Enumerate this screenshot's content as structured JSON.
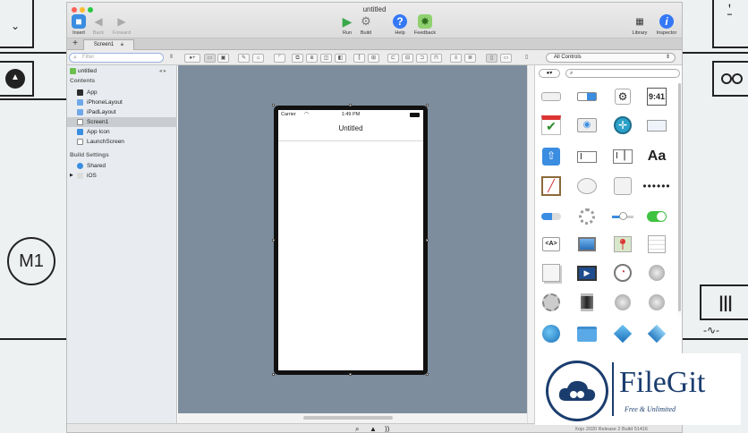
{
  "window": {
    "title": "untitled",
    "toolbar": {
      "insert": "Insert",
      "back": "Back",
      "forward": "Forward",
      "run": "Run",
      "build": "Build",
      "help": "Help",
      "feedback": "Feedback",
      "library": "Library",
      "inspector": "Inspector"
    },
    "tab_label": "Screen1"
  },
  "navigator": {
    "search_placeholder": "Filter",
    "root": "untitled",
    "contents_header": "Contents",
    "contents": [
      "App",
      "iPhoneLayout",
      "iPadLayout",
      "Screen1",
      "App Icon",
      "LaunchScreen"
    ],
    "selected": "Screen1",
    "build_header": "Build Settings",
    "build_items": [
      "Shared",
      "iOS"
    ]
  },
  "device": {
    "carrier": "Carrier",
    "time": "1:49 PM",
    "nav_title": "Untitled"
  },
  "library": {
    "filter": "All Controls",
    "clock_tile_text": "9:41",
    "label_tile_text": "Aa",
    "html_tile_text": "<A>"
  },
  "status": {
    "build_info": "Xojo 2020 Release 2 Build 51416"
  },
  "watermark": {
    "brand": "FileGit",
    "tagline": "Free & Unlimited"
  },
  "background": {
    "badge": "M1"
  },
  "colors": {
    "canvas": "#7d8d9d",
    "accent": "#3478f6",
    "run_green": "#3aa84a",
    "brand_blue": "#1b3d6e"
  }
}
